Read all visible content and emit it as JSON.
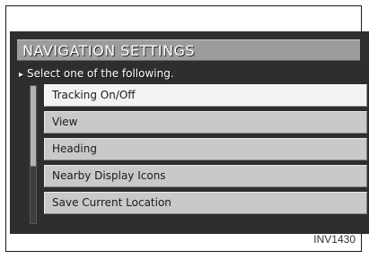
{
  "screen": {
    "title": "NAVIGATION SETTINGS",
    "subtitle": "Select one of the following.",
    "bullet_icon": "small-triangle-icon",
    "menu_items": [
      {
        "label": "Tracking On/Off",
        "selected": true
      },
      {
        "label": "View",
        "selected": false
      },
      {
        "label": "Heading",
        "selected": false
      },
      {
        "label": "Nearby Display Icons",
        "selected": false
      },
      {
        "label": "Save Current Location",
        "selected": false
      }
    ],
    "scroll_position": 0
  },
  "figure_id": "INV1430",
  "colors": {
    "screen_bg": "#2e2e2e",
    "title_bar": "#9c9c9c",
    "menu_item": "#c9c9c9",
    "menu_item_selected": "#f3f3f3",
    "text_dark": "#1a1a1a"
  }
}
